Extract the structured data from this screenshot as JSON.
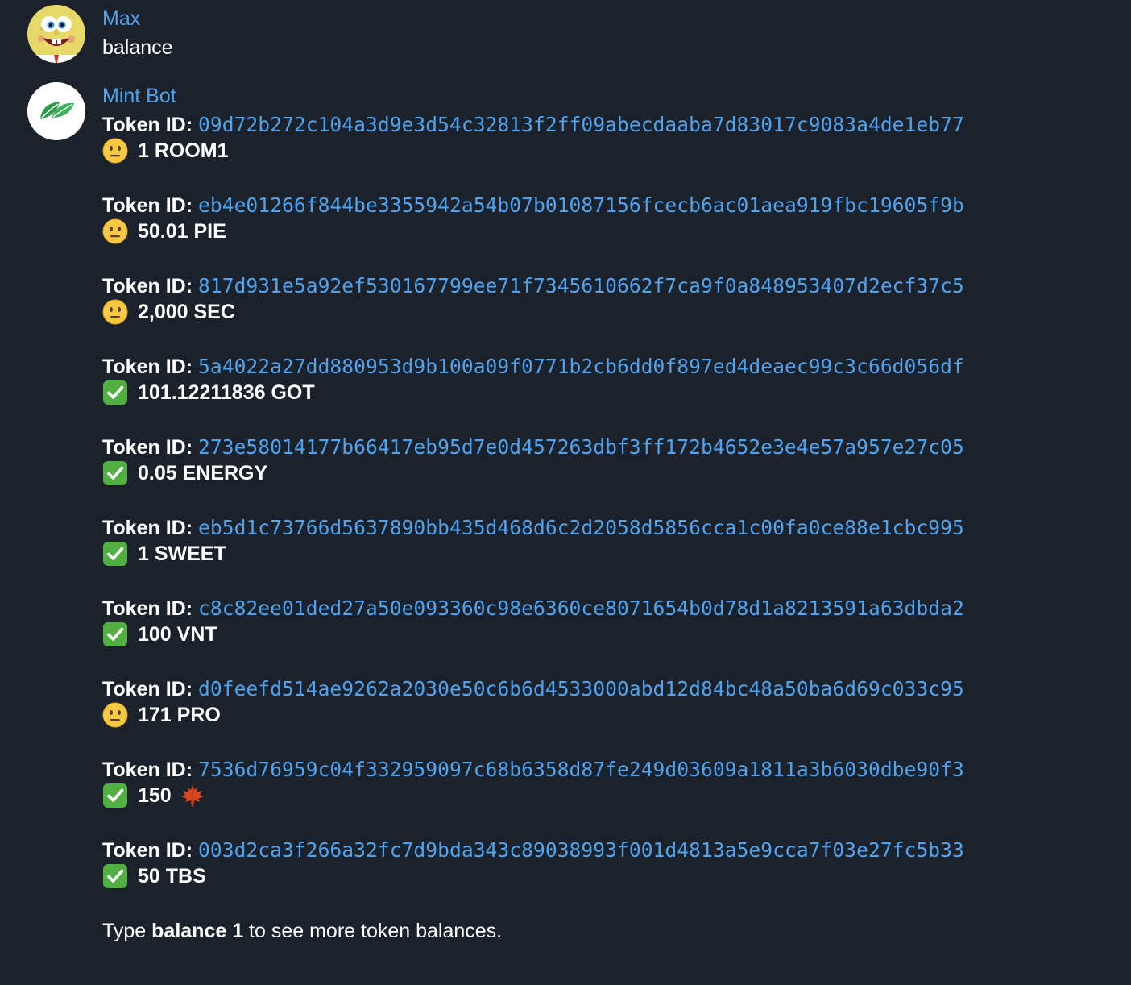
{
  "messages": [
    {
      "sender": "Max",
      "text": "balance",
      "avatar_icon": "spongebob-avatar-icon"
    },
    {
      "sender": "Mint Bot",
      "avatar_icon": "mint-leaf-avatar-icon",
      "token_label": "Token ID:",
      "tokens": [
        {
          "id": "09d72b272c104a3d9e3d54c32813f2ff09abecdaaba7d83017c9083a4de1eb77",
          "status": "neutral",
          "status_icon": "neutral-face-icon",
          "amount": "1 ROOM1"
        },
        {
          "id": "eb4e01266f844be3355942a54b07b01087156fcecb6ac01aea919fbc19605f9b",
          "status": "neutral",
          "status_icon": "neutral-face-icon",
          "amount": "50.01 PIE"
        },
        {
          "id": "817d931e5a92ef530167799ee71f7345610662f7ca9f0a848953407d2ecf37c5",
          "status": "neutral",
          "status_icon": "neutral-face-icon",
          "amount": "2,000 SEC"
        },
        {
          "id": "5a4022a27dd880953d9b100a09f0771b2cb6dd0f897ed4deaec99c3c66d056df",
          "status": "verified",
          "status_icon": "check-mark-icon",
          "amount": "101.12211836 GOT"
        },
        {
          "id": "273e58014177b66417eb95d7e0d457263dbf3ff172b4652e3e4e57a957e27c05",
          "status": "verified",
          "status_icon": "check-mark-icon",
          "amount": "0.05 ENERGY"
        },
        {
          "id": "eb5d1c73766d5637890bb435d468d6c2d2058d5856cca1c00fa0ce88e1cbc995",
          "status": "verified",
          "status_icon": "check-mark-icon",
          "amount": "1 SWEET"
        },
        {
          "id": "c8c82ee01ded27a50e093360c98e6360ce8071654b0d78d1a8213591a63dbda2",
          "status": "verified",
          "status_icon": "check-mark-icon",
          "amount": "100 VNT"
        },
        {
          "id": "d0feefd514ae9262a2030e50c6b6d4533000abd12d84bc48a50ba6d69c033c95",
          "status": "neutral",
          "status_icon": "neutral-face-icon",
          "amount": "171 PRO"
        },
        {
          "id": "7536d76959c04f332959097c68b6358d87fe249d03609a1811a3b6030dbe90f3",
          "status": "verified",
          "status_icon": "check-mark-icon",
          "amount": "150",
          "suffix_icon": "maple-leaf-icon"
        },
        {
          "id": "003d2ca3f266a32fc7d9bda343c89038993f001d4813a5e9cca7f03e27fc5b33",
          "status": "verified",
          "status_icon": "check-mark-icon",
          "amount": "50 TBS"
        }
      ],
      "footer": {
        "prefix": "Type ",
        "command": "balance 1",
        "suffix": " to see more token balances."
      }
    }
  ],
  "colors": {
    "background": "#1b222c",
    "sender_name": "#4fa3ef",
    "token_id": "#4fa3ef",
    "text": "#ffffff",
    "check_green": "#52b043",
    "face_yellow": "#f7c844"
  }
}
